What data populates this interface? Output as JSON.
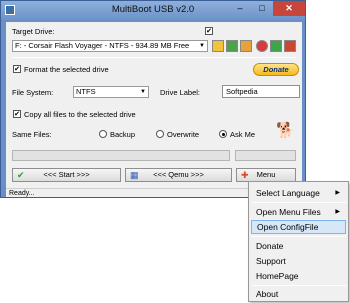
{
  "window": {
    "title": "MultiBoot USB v2.0",
    "minimize_glyph": "–",
    "maximize_glyph": "□",
    "close_glyph": "✕"
  },
  "target": {
    "label": "Target Drive:",
    "drive_value": "F: - Corsair Flash Voyager - NTFS - 934.89 MB Free",
    "toolbar_icons": [
      "folder-icon",
      "refresh-icon",
      "info-icon",
      "globe-icon",
      "install-icon",
      "tools-icon"
    ]
  },
  "format": {
    "label": "Format the selected drive",
    "checked": true
  },
  "donate": {
    "label": "Donate"
  },
  "filesystem": {
    "label": "File System:",
    "value": "NTFS"
  },
  "drive_label": {
    "label": "Drive Label:",
    "value": "Softpedia"
  },
  "copy_files": {
    "label": "Copy all files to the selected drive",
    "checked": true
  },
  "same_files": {
    "label": "Same Files:",
    "options": [
      "Backup",
      "Overwrite",
      "Ask Me"
    ],
    "selected": "Ask Me"
  },
  "buttons": {
    "start": "<<< Start >>>",
    "qemu": "<<< Qemu >>>",
    "menu": "Menu"
  },
  "status": {
    "text": "Ready..."
  },
  "context_menu": {
    "items": [
      {
        "label": "Select Language",
        "submenu": true
      },
      {
        "label": "Open Menu Files",
        "submenu": true
      },
      {
        "label": "Open ConfigFile",
        "highlighted": true
      },
      {
        "label": "Donate"
      },
      {
        "label": "Support"
      },
      {
        "label": "HomePage"
      },
      {
        "label": "About"
      }
    ]
  },
  "colors": {
    "window_frame": "#6a8fc6",
    "close_button": "#c7463b",
    "menu_highlight": "#d6e8f8",
    "donate_button": "#f3b91c"
  }
}
